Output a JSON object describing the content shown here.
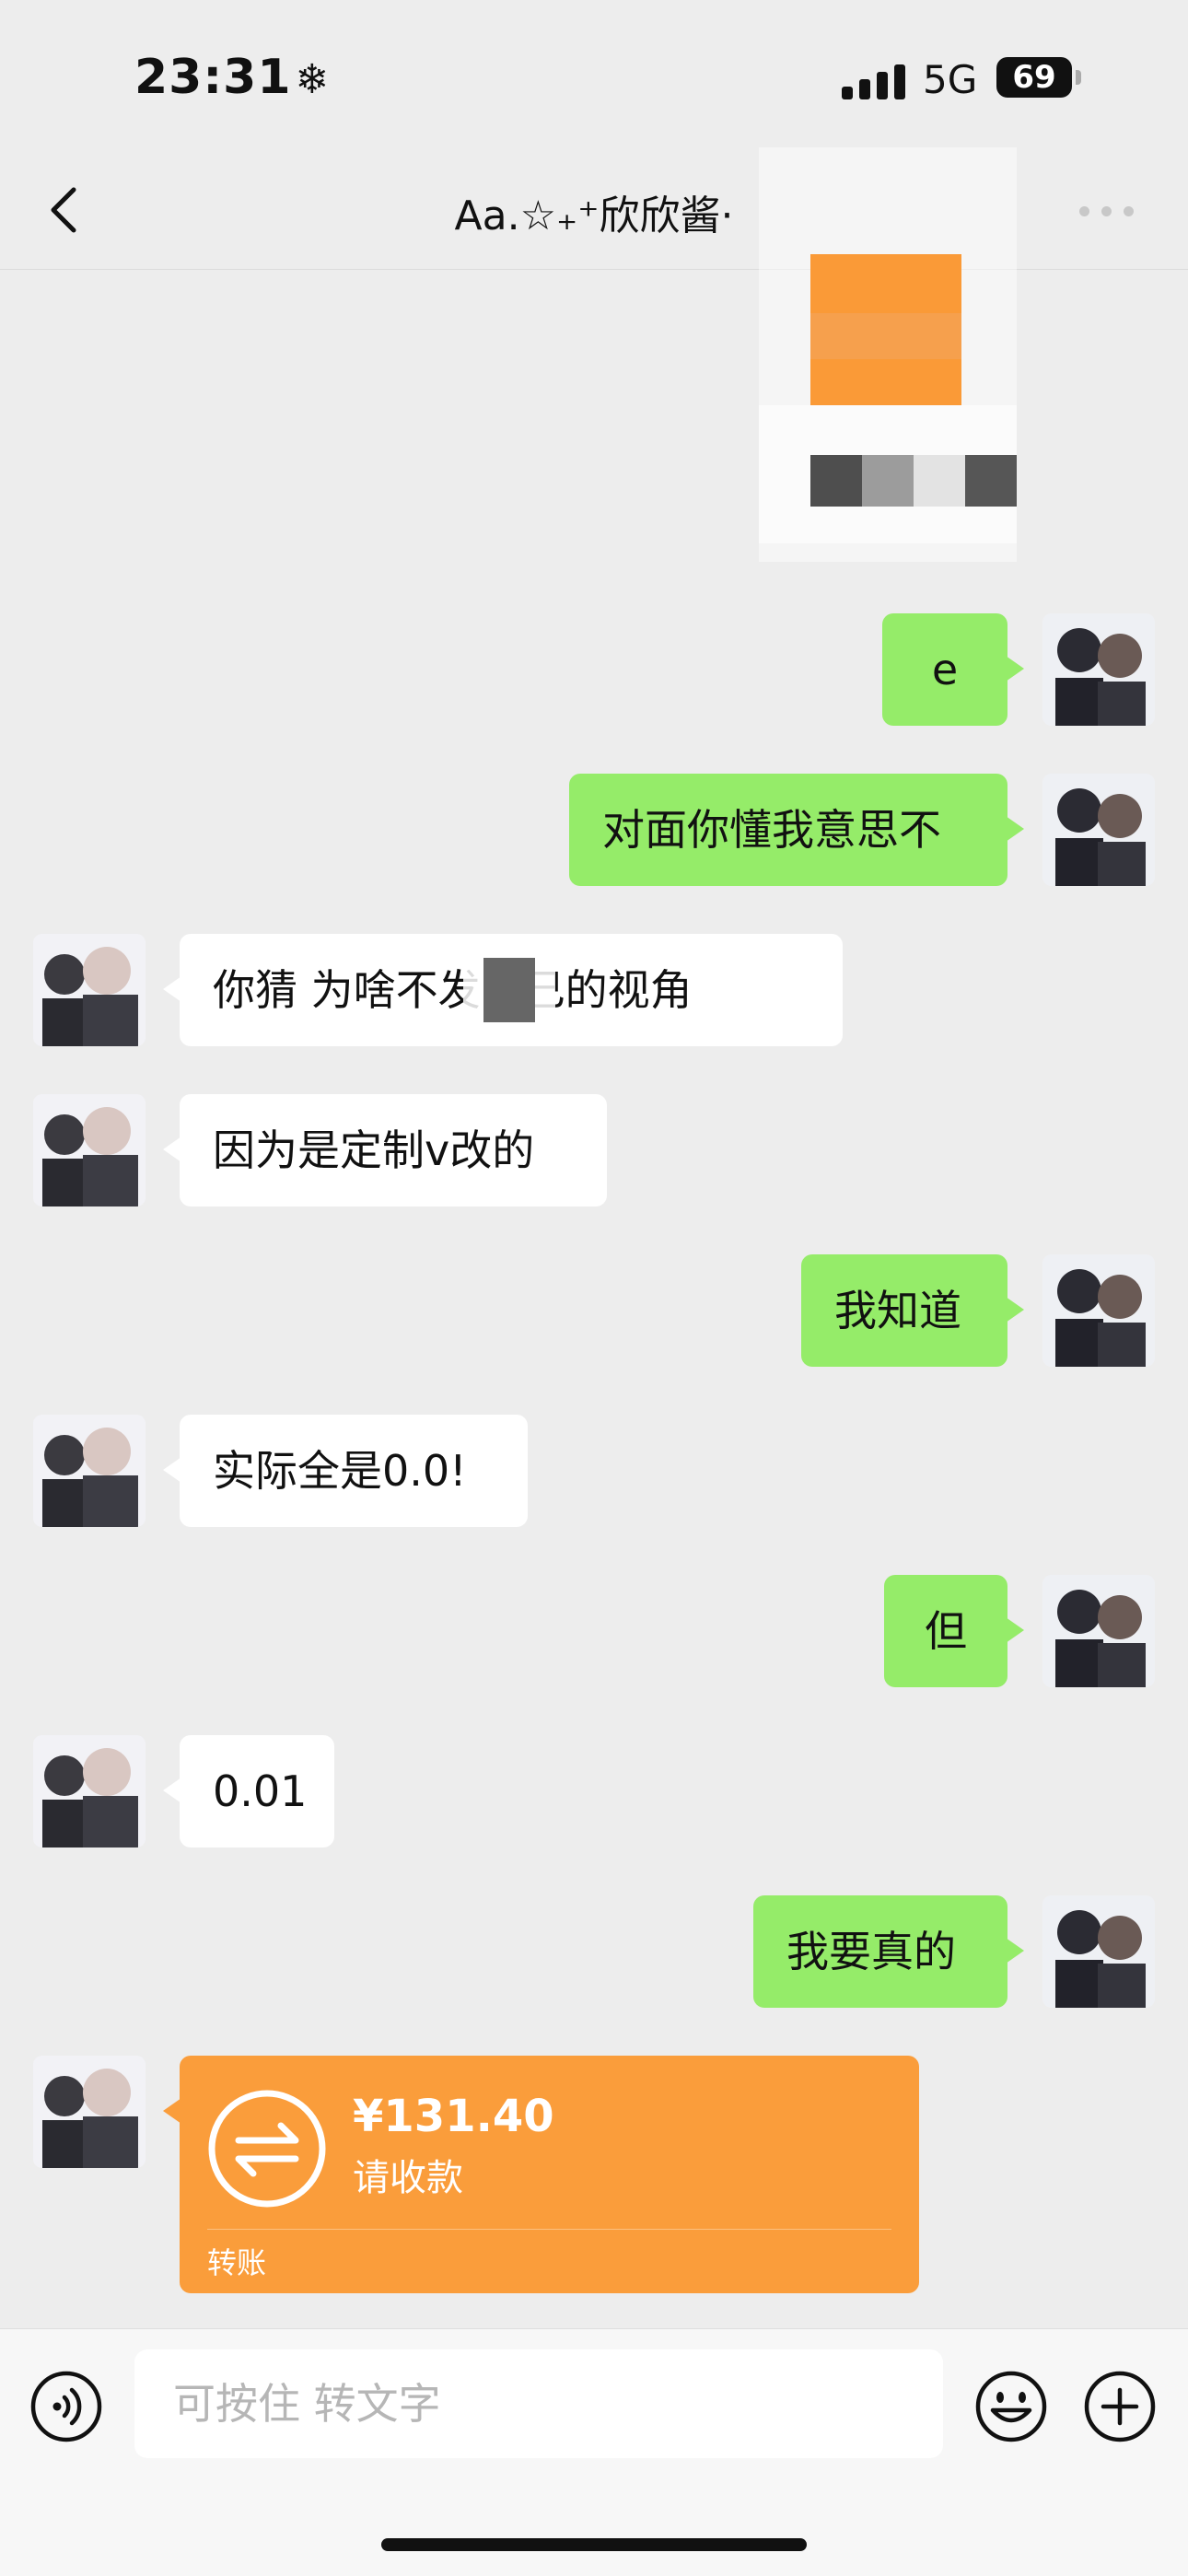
{
  "status_bar": {
    "time": "23:31",
    "time_icon": "❄",
    "network": "5G",
    "battery": "69"
  },
  "nav": {
    "title": "Aa.☆₊⁺欣欣酱·"
  },
  "messages": [
    {
      "side": "out",
      "text": "e"
    },
    {
      "side": "out",
      "text": "对面你懂我意思不"
    },
    {
      "side": "in",
      "text": "你猜     为啥不发自己的视角"
    },
    {
      "side": "in",
      "text": "因为是定制v改的"
    },
    {
      "side": "out",
      "text": "我知道"
    },
    {
      "side": "in",
      "text": "实际全是0.0!"
    },
    {
      "side": "out",
      "text": "但"
    },
    {
      "side": "in",
      "text": "0.01"
    },
    {
      "side": "out",
      "text": "我要真的"
    }
  ],
  "transfer": {
    "amount": "¥131.40",
    "status": "请收款",
    "label": "转账"
  },
  "input": {
    "placeholder": "可按住 转文字"
  },
  "colors": {
    "outgoing_bubble": "#95ec69",
    "incoming_bubble": "#ffffff",
    "transfer_card": "#fa9d3b",
    "background": "#ededed"
  },
  "icons": {
    "back": "chevron-left-icon",
    "more": "more-icon",
    "voice": "voice-icon",
    "emoji": "emoji-icon",
    "plus": "plus-icon",
    "transfer": "transfer-arrows-icon"
  }
}
